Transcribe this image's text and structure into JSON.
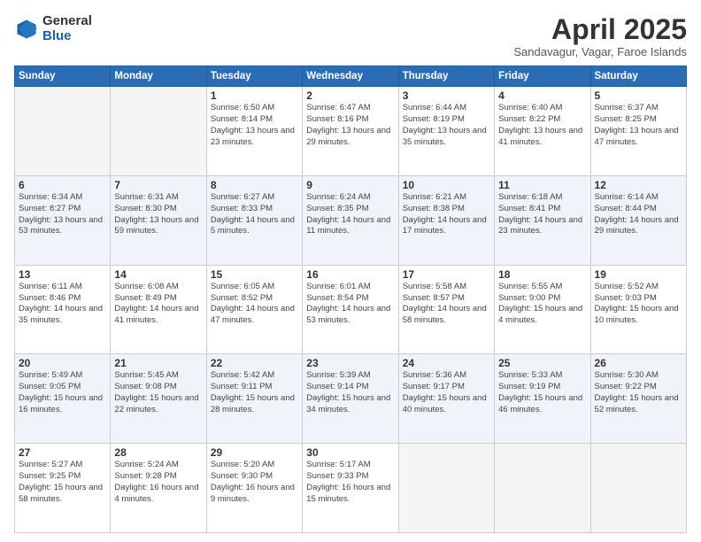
{
  "logo": {
    "general": "General",
    "blue": "Blue"
  },
  "title": "April 2025",
  "location": "Sandavagur, Vagar, Faroe Islands",
  "headers": [
    "Sunday",
    "Monday",
    "Tuesday",
    "Wednesday",
    "Thursday",
    "Friday",
    "Saturday"
  ],
  "weeks": [
    [
      {
        "day": "",
        "info": ""
      },
      {
        "day": "",
        "info": ""
      },
      {
        "day": "1",
        "info": "Sunrise: 6:50 AM\nSunset: 8:14 PM\nDaylight: 13 hours\nand 23 minutes."
      },
      {
        "day": "2",
        "info": "Sunrise: 6:47 AM\nSunset: 8:16 PM\nDaylight: 13 hours\nand 29 minutes."
      },
      {
        "day": "3",
        "info": "Sunrise: 6:44 AM\nSunset: 8:19 PM\nDaylight: 13 hours\nand 35 minutes."
      },
      {
        "day": "4",
        "info": "Sunrise: 6:40 AM\nSunset: 8:22 PM\nDaylight: 13 hours\nand 41 minutes."
      },
      {
        "day": "5",
        "info": "Sunrise: 6:37 AM\nSunset: 8:25 PM\nDaylight: 13 hours\nand 47 minutes."
      }
    ],
    [
      {
        "day": "6",
        "info": "Sunrise: 6:34 AM\nSunset: 8:27 PM\nDaylight: 13 hours\nand 53 minutes."
      },
      {
        "day": "7",
        "info": "Sunrise: 6:31 AM\nSunset: 8:30 PM\nDaylight: 13 hours\nand 59 minutes."
      },
      {
        "day": "8",
        "info": "Sunrise: 6:27 AM\nSunset: 8:33 PM\nDaylight: 14 hours\nand 5 minutes."
      },
      {
        "day": "9",
        "info": "Sunrise: 6:24 AM\nSunset: 8:35 PM\nDaylight: 14 hours\nand 11 minutes."
      },
      {
        "day": "10",
        "info": "Sunrise: 6:21 AM\nSunset: 8:38 PM\nDaylight: 14 hours\nand 17 minutes."
      },
      {
        "day": "11",
        "info": "Sunrise: 6:18 AM\nSunset: 8:41 PM\nDaylight: 14 hours\nand 23 minutes."
      },
      {
        "day": "12",
        "info": "Sunrise: 6:14 AM\nSunset: 8:44 PM\nDaylight: 14 hours\nand 29 minutes."
      }
    ],
    [
      {
        "day": "13",
        "info": "Sunrise: 6:11 AM\nSunset: 8:46 PM\nDaylight: 14 hours\nand 35 minutes."
      },
      {
        "day": "14",
        "info": "Sunrise: 6:08 AM\nSunset: 8:49 PM\nDaylight: 14 hours\nand 41 minutes."
      },
      {
        "day": "15",
        "info": "Sunrise: 6:05 AM\nSunset: 8:52 PM\nDaylight: 14 hours\nand 47 minutes."
      },
      {
        "day": "16",
        "info": "Sunrise: 6:01 AM\nSunset: 8:54 PM\nDaylight: 14 hours\nand 53 minutes."
      },
      {
        "day": "17",
        "info": "Sunrise: 5:58 AM\nSunset: 8:57 PM\nDaylight: 14 hours\nand 58 minutes."
      },
      {
        "day": "18",
        "info": "Sunrise: 5:55 AM\nSunset: 9:00 PM\nDaylight: 15 hours\nand 4 minutes."
      },
      {
        "day": "19",
        "info": "Sunrise: 5:52 AM\nSunset: 9:03 PM\nDaylight: 15 hours\nand 10 minutes."
      }
    ],
    [
      {
        "day": "20",
        "info": "Sunrise: 5:49 AM\nSunset: 9:05 PM\nDaylight: 15 hours\nand 16 minutes."
      },
      {
        "day": "21",
        "info": "Sunrise: 5:45 AM\nSunset: 9:08 PM\nDaylight: 15 hours\nand 22 minutes."
      },
      {
        "day": "22",
        "info": "Sunrise: 5:42 AM\nSunset: 9:11 PM\nDaylight: 15 hours\nand 28 minutes."
      },
      {
        "day": "23",
        "info": "Sunrise: 5:39 AM\nSunset: 9:14 PM\nDaylight: 15 hours\nand 34 minutes."
      },
      {
        "day": "24",
        "info": "Sunrise: 5:36 AM\nSunset: 9:17 PM\nDaylight: 15 hours\nand 40 minutes."
      },
      {
        "day": "25",
        "info": "Sunrise: 5:33 AM\nSunset: 9:19 PM\nDaylight: 15 hours\nand 46 minutes."
      },
      {
        "day": "26",
        "info": "Sunrise: 5:30 AM\nSunset: 9:22 PM\nDaylight: 15 hours\nand 52 minutes."
      }
    ],
    [
      {
        "day": "27",
        "info": "Sunrise: 5:27 AM\nSunset: 9:25 PM\nDaylight: 15 hours\nand 58 minutes."
      },
      {
        "day": "28",
        "info": "Sunrise: 5:24 AM\nSunset: 9:28 PM\nDaylight: 16 hours\nand 4 minutes."
      },
      {
        "day": "29",
        "info": "Sunrise: 5:20 AM\nSunset: 9:30 PM\nDaylight: 16 hours\nand 9 minutes."
      },
      {
        "day": "30",
        "info": "Sunrise: 5:17 AM\nSunset: 9:33 PM\nDaylight: 16 hours\nand 15 minutes."
      },
      {
        "day": "",
        "info": ""
      },
      {
        "day": "",
        "info": ""
      },
      {
        "day": "",
        "info": ""
      }
    ]
  ]
}
